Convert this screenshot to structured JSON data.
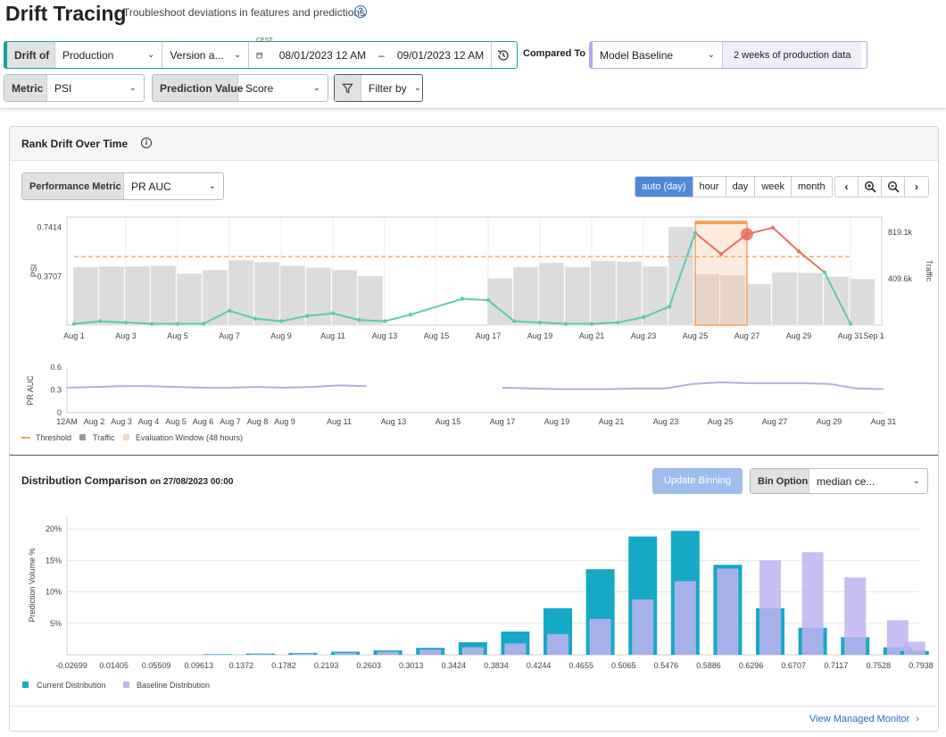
{
  "header": {
    "title": "Drift Tracing",
    "subtitle": "Troubleshoot deviations in features and predictions",
    "drift_of_label": "Drift of",
    "environment": "Production",
    "version": "Version a...",
    "timezone": "CEST",
    "date_start": "08/01/2023 12 AM",
    "date_sep": "–",
    "date_end": "09/01/2023 12 AM",
    "compared_to_label": "Compared To",
    "baseline": "Model Baseline",
    "baseline_desc": "2 weeks of production data",
    "metric_label": "Metric",
    "metric_value": "PSI",
    "pred_label": "Prediction Value",
    "pred_value": "Score",
    "filter_label": "Filter by"
  },
  "rank_card": {
    "title": "Rank Drift Over Time",
    "perf_label": "Performance Metric",
    "perf_value": "PR AUC",
    "granularity": [
      "auto (day)",
      "hour",
      "day",
      "week",
      "month"
    ],
    "nav_icons": [
      "chevron-left",
      "zoom-in",
      "zoom-out",
      "chevron-right"
    ],
    "legend": [
      "Threshold",
      "Traffic",
      "Evaluation Window (48 hours)"
    ]
  },
  "dist_card": {
    "title": "Distribution Comparison",
    "on_label": "on 27/08/2023 00:00",
    "update_btn": "Update Binning",
    "bin_label": "Bin Option",
    "bin_value": "median ce...",
    "legend": [
      "Current Distribution",
      "Baseline Distribution"
    ],
    "footer_link": "View Managed Monitor"
  },
  "colors": {
    "teal": "#1aa0a0",
    "psi_line": "#5cc9b0",
    "psi_alert": "#e8705d",
    "threshold": "#f2a35e",
    "traffic": "#dcdcdc",
    "pr_auc": "#b8ade0",
    "current": "#16a9c6",
    "baseline": "#c0b3f0",
    "accent": "#4f87d9"
  },
  "chart_data": [
    {
      "type": "line",
      "name": "psi_traffic",
      "ylabel": "PSI",
      "y2label": "Traffic",
      "y_ticks": [
        "0.3707",
        "0.7414"
      ],
      "y_tick_values": [
        0.3707,
        0.7414
      ],
      "ylim": [
        0,
        0.82
      ],
      "y2_ticks": [
        "409.6k",
        "819.1k"
      ],
      "x_labels": [
        "Aug 1",
        "Aug 3",
        "Aug 5",
        "Aug 7",
        "Aug 9",
        "Aug 11",
        "Aug 13",
        "Aug 15",
        "Aug 17",
        "Aug 19",
        "Aug 21",
        "Aug 23",
        "Aug 25",
        "Aug 27",
        "Aug 29",
        "Aug 31",
        "Sep 1"
      ],
      "x_label_days": [
        1,
        3,
        5,
        7,
        9,
        11,
        13,
        15,
        17,
        19,
        21,
        23,
        25,
        27,
        29,
        31,
        31.9
      ],
      "threshold": 0.52,
      "traffic_days": [
        1,
        2,
        3,
        4,
        5,
        6,
        7,
        8,
        9,
        10,
        11,
        12,
        13,
        14,
        15,
        16,
        17,
        18,
        19,
        20,
        21,
        22,
        23,
        24,
        25,
        26,
        27,
        28,
        29,
        30,
        31
      ],
      "traffic": [
        485,
        490,
        490,
        495,
        430,
        460,
        540,
        525,
        495,
        480,
        460,
        410,
        0,
        0,
        0,
        0,
        390,
        485,
        520,
        485,
        535,
        530,
        490,
        820,
        425,
        415,
        345,
        440,
        435,
        405,
        385
      ],
      "psi_days": [
        1,
        2,
        3,
        4,
        5,
        6,
        7,
        8,
        9,
        10,
        11,
        12,
        13,
        14,
        16,
        17,
        18,
        19,
        20,
        21,
        22,
        23,
        24,
        25,
        26,
        27,
        28,
        29,
        30,
        31
      ],
      "psi": [
        0.01,
        0.03,
        0.02,
        0.01,
        0.01,
        0.01,
        0.11,
        0.05,
        0.03,
        0.07,
        0.09,
        0.04,
        0.03,
        0.08,
        0.2,
        0.19,
        0.03,
        0.02,
        0.01,
        0.01,
        0.02,
        0.06,
        0.14,
        0.7,
        0.54,
        0.69,
        0.74,
        0.56,
        0.4,
        0.01
      ],
      "alert_from_index": 23,
      "eval_window": [
        25,
        27
      ],
      "selected_day": 27
    },
    {
      "type": "line",
      "name": "pr_auc",
      "ylabel": "PR AUC",
      "y_ticks": [
        "0",
        "0.3",
        "0.6"
      ],
      "ylim": [
        0,
        0.6
      ],
      "x_labels": [
        "12AM",
        "Aug 2",
        "Aug 3",
        "Aug 4",
        "Aug 5",
        "Aug 6",
        "Aug 7",
        "Aug 8",
        "Aug 9",
        "Aug 11",
        "Aug 13",
        "Aug 15",
        "Aug 17",
        "Aug 19",
        "Aug 21",
        "Aug 23",
        "Aug 25",
        "Aug 27",
        "Aug 29",
        "Aug 31"
      ],
      "x_label_days": [
        1,
        2,
        3,
        4,
        5,
        6,
        7,
        8,
        9,
        11,
        13,
        15,
        17,
        19,
        21,
        23,
        25,
        27,
        29,
        31
      ],
      "segments": [
        {
          "days": [
            1,
            2,
            3,
            4,
            5,
            6,
            7,
            8,
            9,
            10,
            11,
            12
          ],
          "values": [
            0.33,
            0.34,
            0.35,
            0.35,
            0.34,
            0.33,
            0.33,
            0.34,
            0.33,
            0.34,
            0.36,
            0.35
          ]
        },
        {
          "days": [
            17,
            18,
            19,
            20,
            21,
            22,
            23,
            24,
            25,
            26,
            27,
            28,
            29,
            30,
            31
          ],
          "values": [
            0.33,
            0.32,
            0.31,
            0.31,
            0.31,
            0.32,
            0.32,
            0.38,
            0.4,
            0.39,
            0.39,
            0.39,
            0.38,
            0.32,
            0.31
          ]
        }
      ]
    },
    {
      "type": "bar",
      "name": "distribution",
      "ylabel": "Prediction Volume %",
      "y_ticks": [
        "5%",
        "10%",
        "15%",
        "20%"
      ],
      "ylim": [
        0,
        22
      ],
      "x_ticks": [
        "-0.02699",
        "0.01405",
        "0.05509",
        "0.09613",
        "0.1372",
        "0.1782",
        "0.2193",
        "0.2603",
        "0.3013",
        "0.3424",
        "0.3834",
        "0.4244",
        "0.4655",
        "0.5065",
        "0.5476",
        "0.5886",
        "0.6296",
        "0.6707",
        "0.7117",
        "0.7528",
        "0.7938"
      ],
      "series": [
        {
          "name": "Current Distribution",
          "values": [
            0,
            0,
            0,
            0.1,
            0.2,
            0.3,
            0.5,
            0.7,
            1.1,
            2.0,
            3.7,
            7.4,
            13.6,
            18.8,
            19.7,
            14.3,
            7.4,
            4.3,
            2.8,
            1.2,
            0.6
          ]
        },
        {
          "name": "Baseline Distribution",
          "values": [
            0,
            0,
            0,
            0,
            0.1,
            0.2,
            0.3,
            0.5,
            0.8,
            1.2,
            1.8,
            3.3,
            5.7,
            8.8,
            11.7,
            13.7,
            15.0,
            16.3,
            12.3,
            5.5,
            2.1
          ]
        }
      ]
    }
  ]
}
